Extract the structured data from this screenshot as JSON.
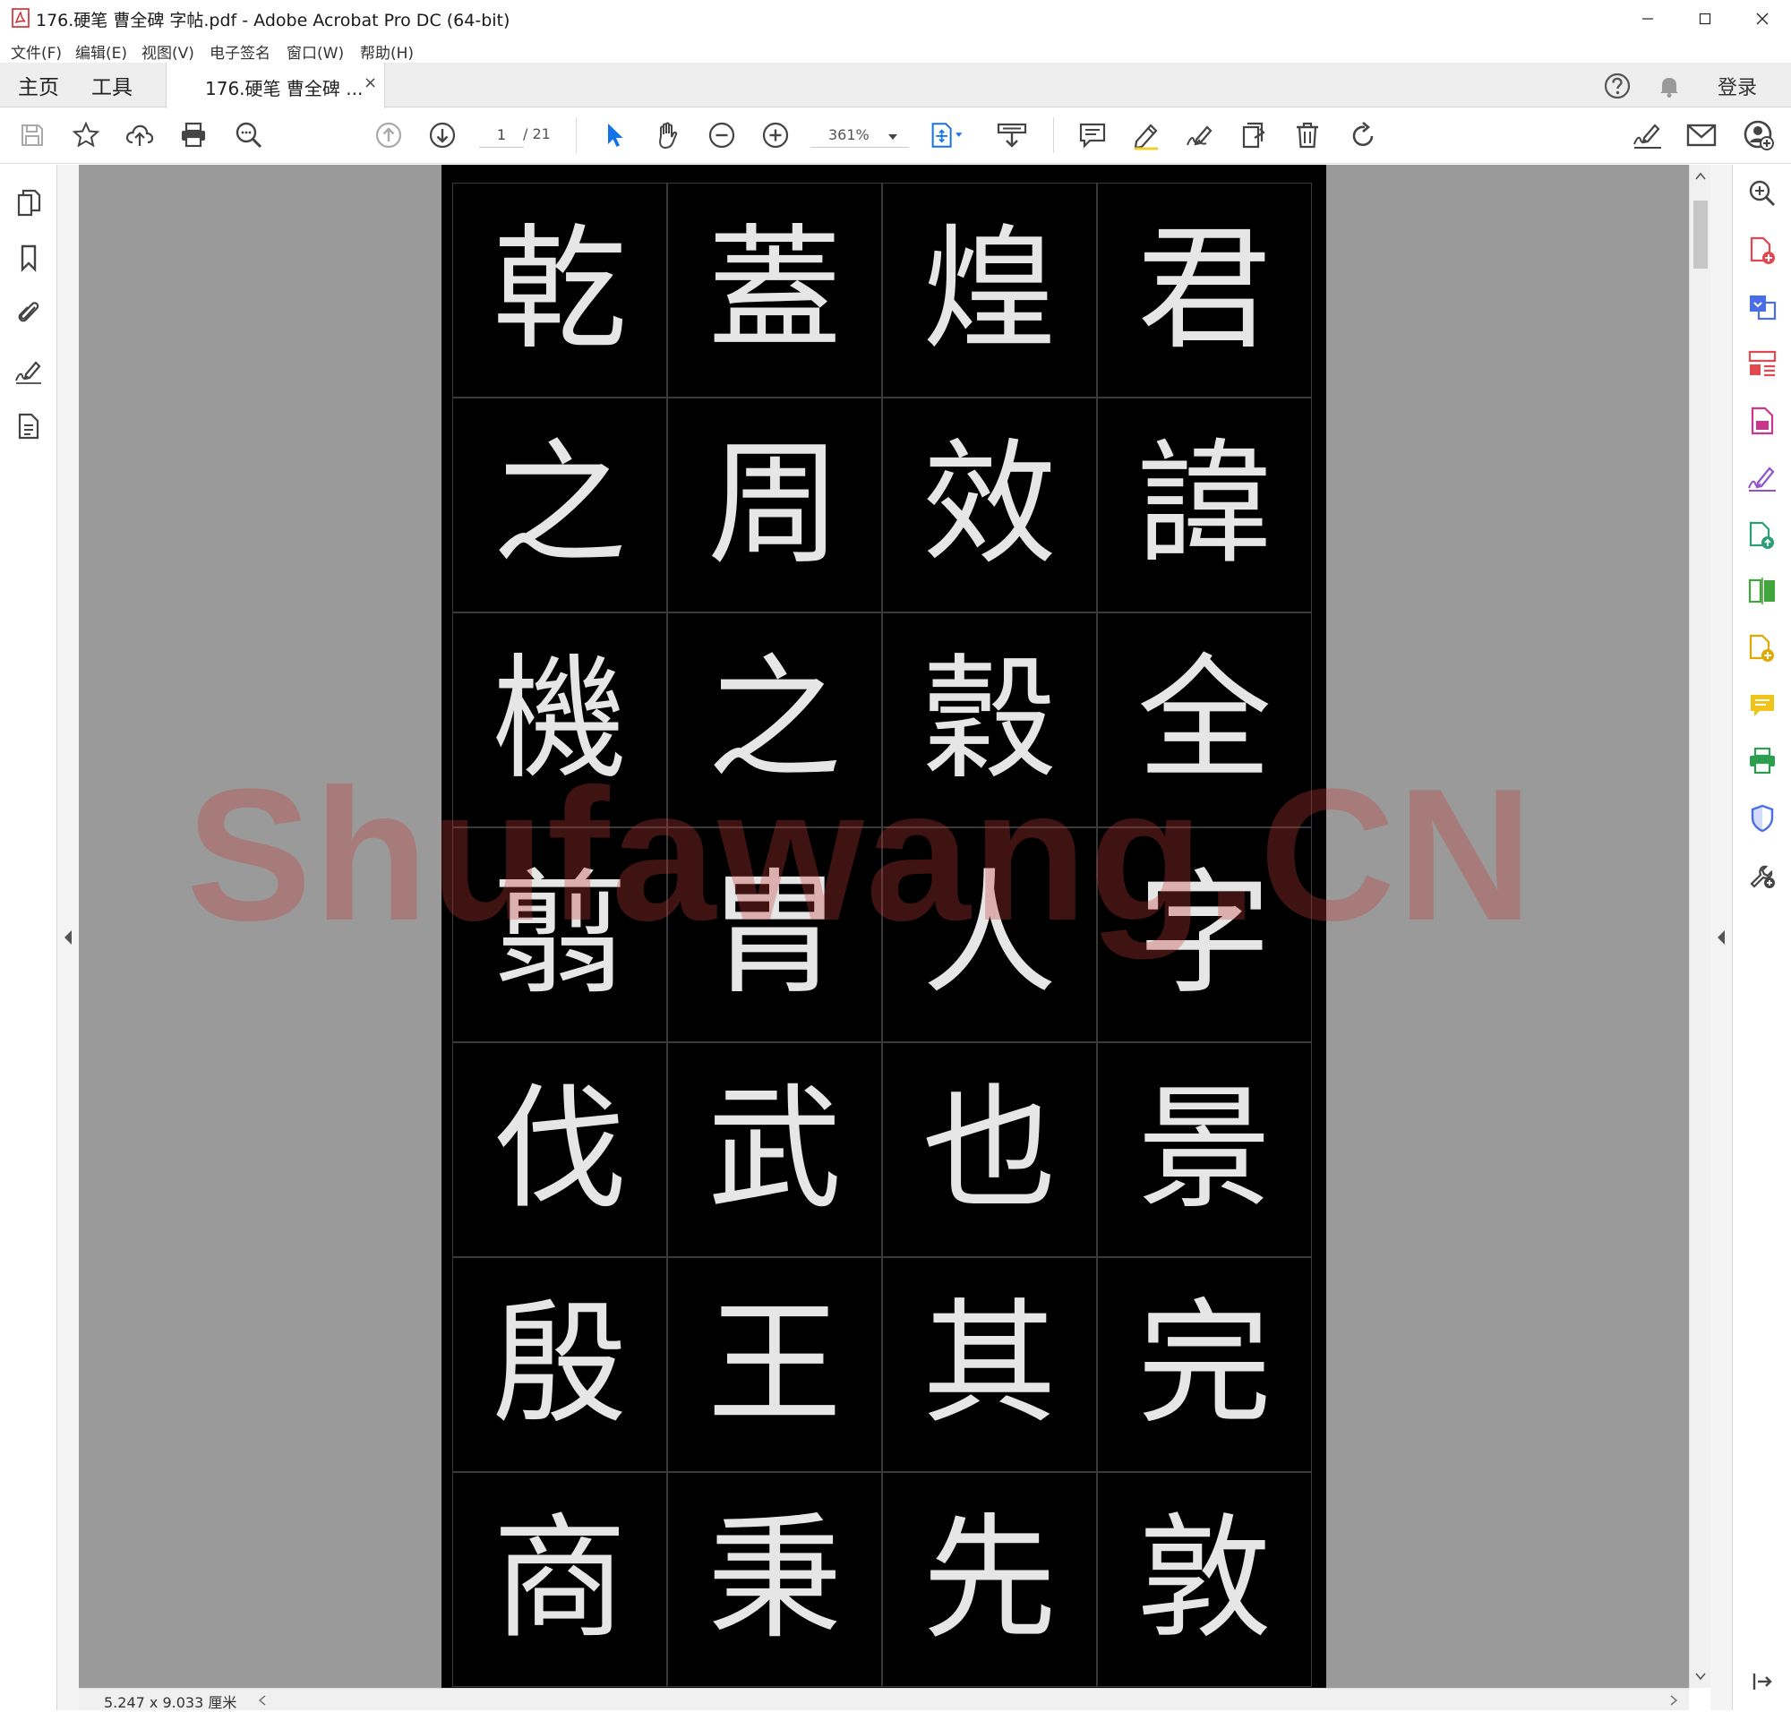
{
  "window": {
    "title": "176.硬笔 曹全碑 字帖.pdf - Adobe Acrobat Pro DC (64-bit)"
  },
  "menu": [
    "文件(F)",
    "编辑(E)",
    "视图(V)",
    "电子签名",
    "窗口(W)",
    "帮助(H)"
  ],
  "tabs": {
    "home": "主页",
    "tools": "工具",
    "document": "176.硬笔 曹全碑 ...",
    "close": "×"
  },
  "header": {
    "login": "登录"
  },
  "toolbar": {
    "page_current": "1",
    "page_total": "/ 21",
    "zoom": "361%"
  },
  "document": {
    "columns": [
      [
        "君",
        "諱",
        "全",
        "字",
        "景",
        "完",
        "敦"
      ],
      [
        "煌",
        "效",
        "穀",
        "人",
        "也",
        "其",
        "先"
      ],
      [
        "蓋",
        "周",
        "之",
        "胄",
        "武",
        "王",
        "秉"
      ],
      [
        "乾",
        "之",
        "機",
        "翦",
        "伐",
        "殷",
        "商"
      ]
    ],
    "watermark": "Shufawang.CN"
  },
  "status": {
    "page_size": "5.247 x 9.033 厘米"
  },
  "colors": {
    "accent_blue": "#1473e6",
    "acrobat_red": "#d4242b",
    "doc_background": "#9a9a9a"
  }
}
